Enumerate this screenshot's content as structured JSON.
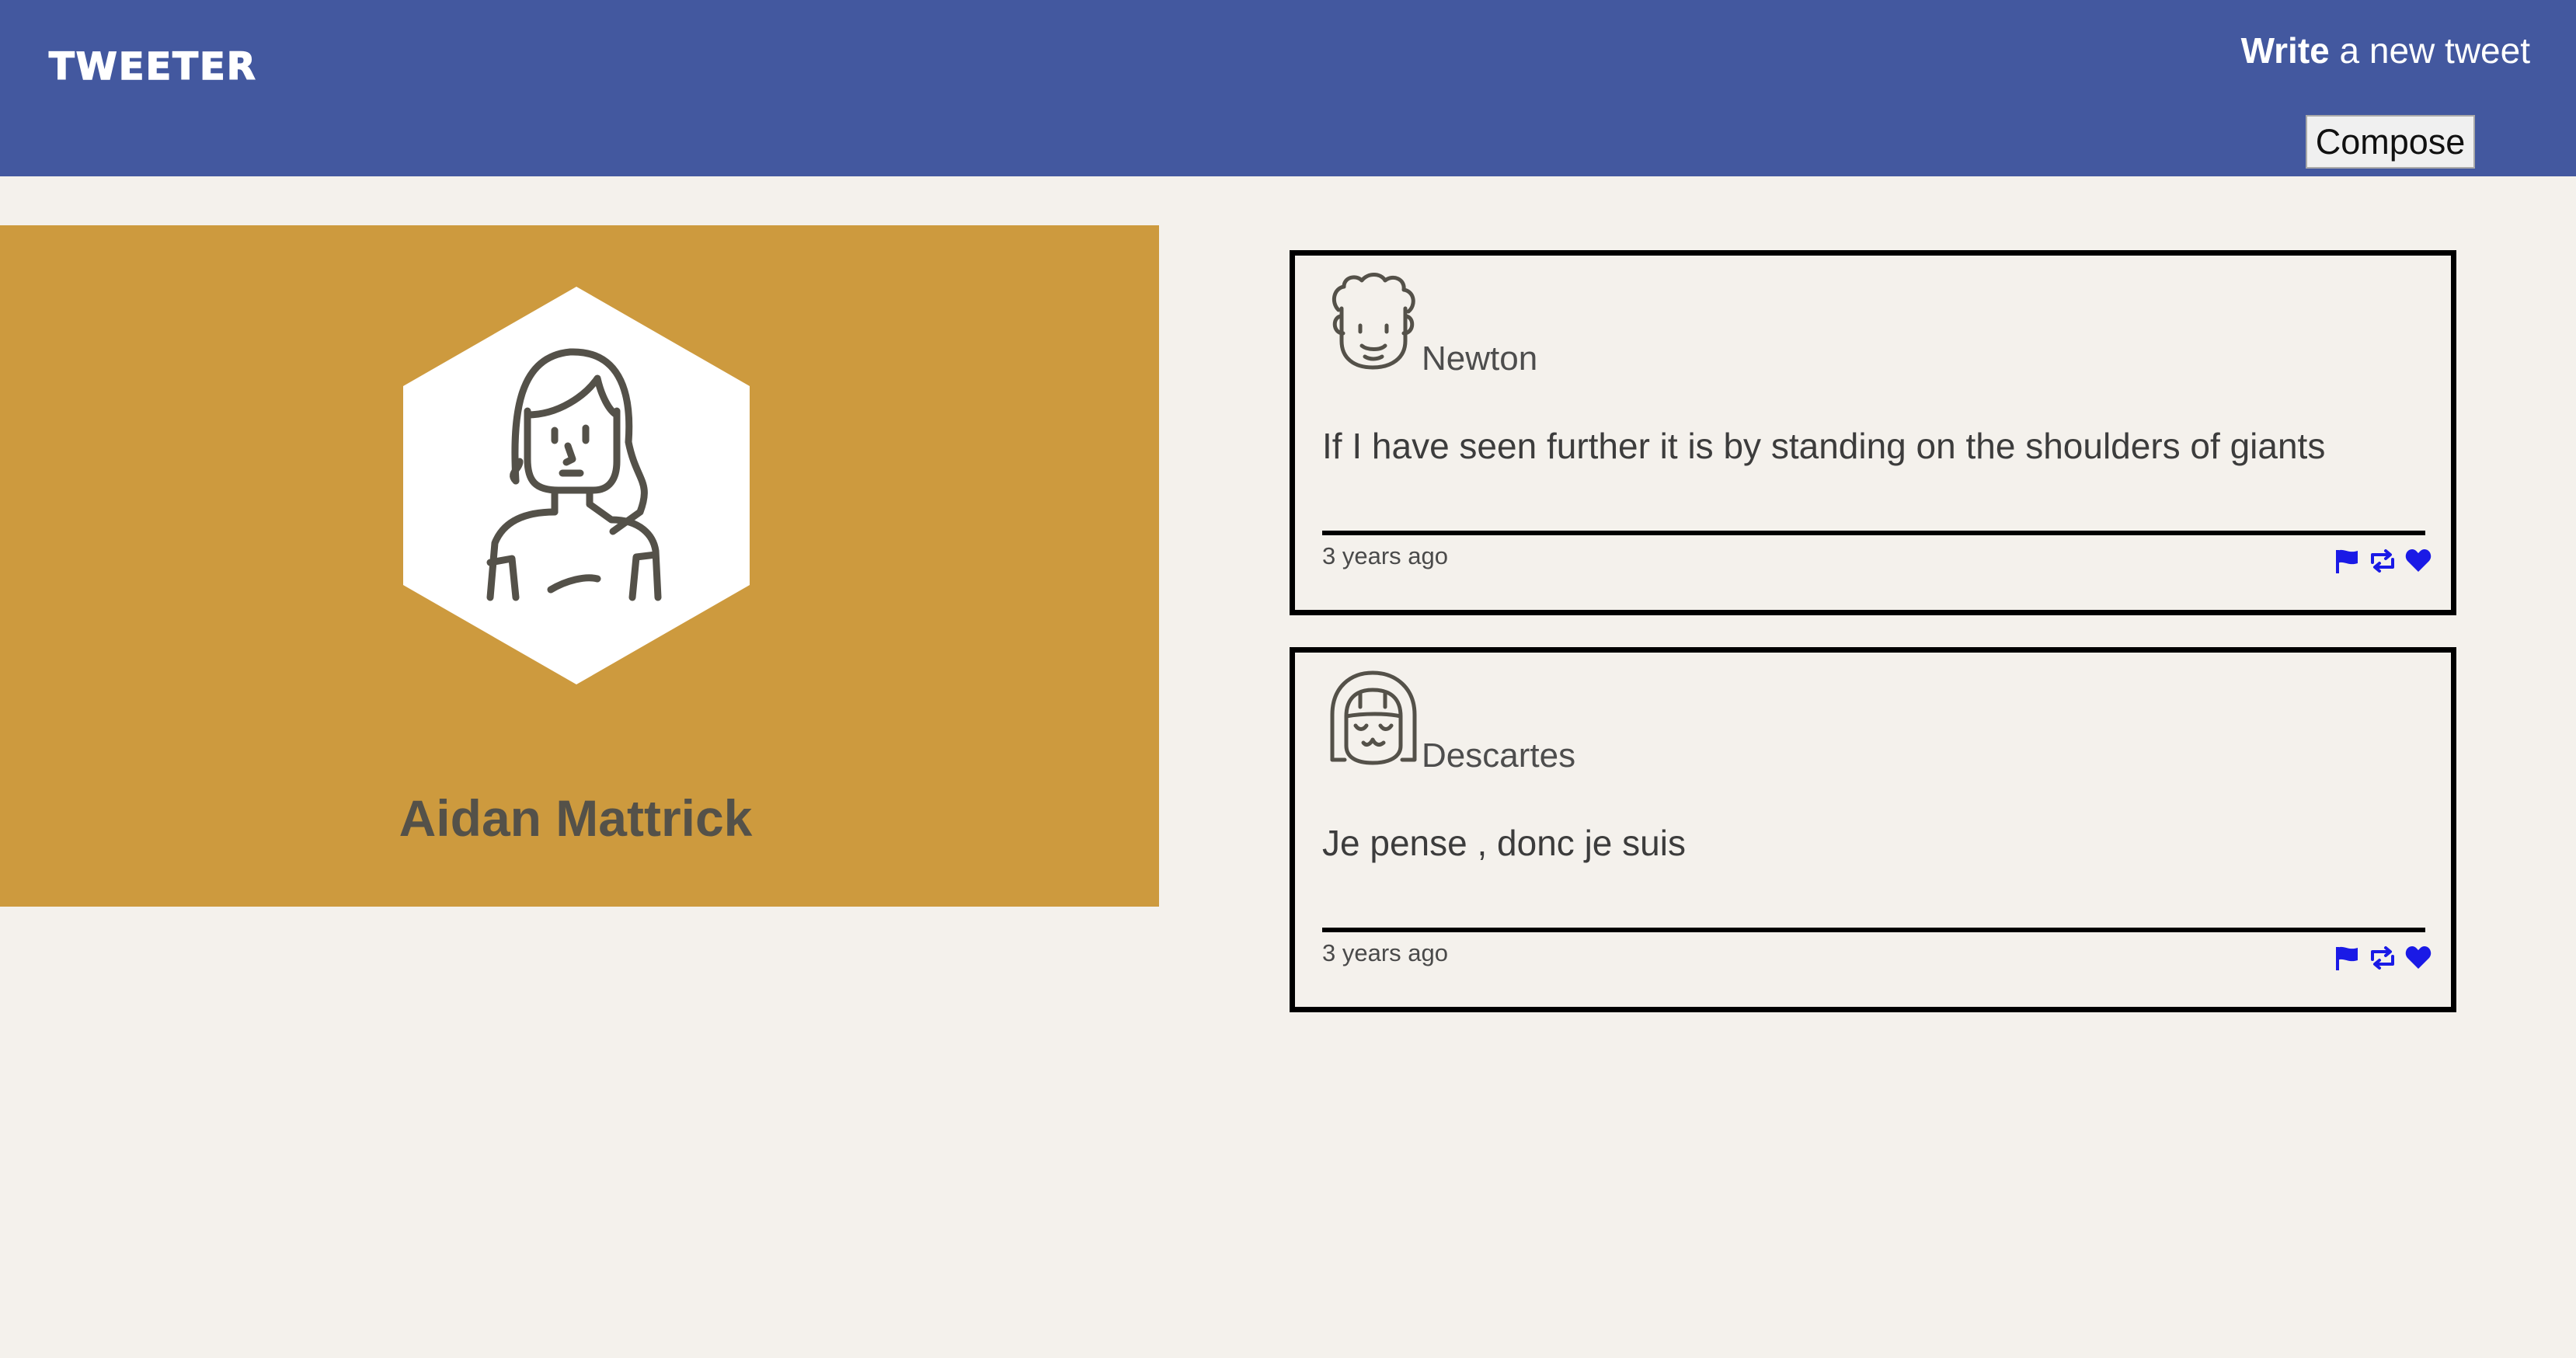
{
  "nav": {
    "logo": "TWEETER",
    "write_bold": "Write",
    "write_rest": " a new tweet",
    "compose_label": "Compose",
    "background_color": "#43589f"
  },
  "profile": {
    "name": "Aidan Mattrick",
    "avatar_icon": "woman-avatar-icon",
    "background_color": "#cd9a3e"
  },
  "tweets": [
    {
      "avatar_icon": "curly-hair-avatar-icon",
      "handle": "Newton",
      "text": "If I have seen further it is by standing on the shoulders of giants",
      "time": "3 years ago",
      "actions": [
        "flag-icon",
        "retweet-icon",
        "heart-icon"
      ]
    },
    {
      "avatar_icon": "bob-hair-avatar-icon",
      "handle": "Descartes",
      "text": "Je pense , donc je suis",
      "time": "3 years ago",
      "actions": [
        "flag-icon",
        "retweet-icon",
        "heart-icon"
      ]
    }
  ],
  "colors": {
    "page_bg": "#f4f1ec",
    "action_icon": "#1a1ae6",
    "line_art": "#545149"
  }
}
